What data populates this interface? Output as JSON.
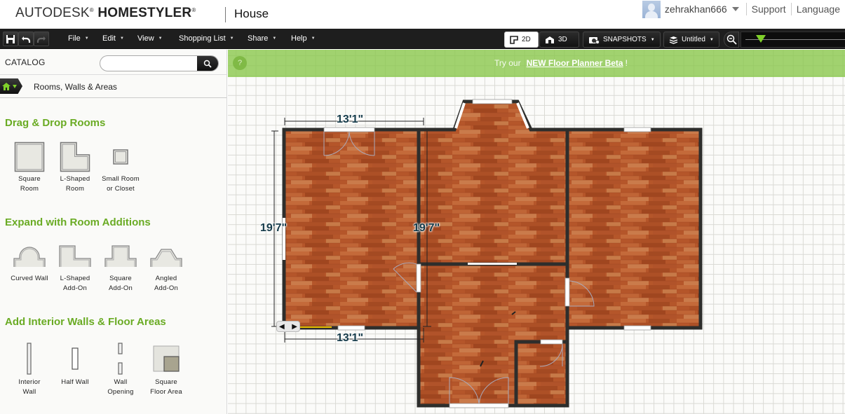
{
  "header": {
    "brand_light": "AUTODESK",
    "brand_bold": "HOMESTYLER",
    "registered": "®",
    "project_name": "House",
    "username": "zehrakhan666",
    "links": [
      "Support",
      "Language"
    ]
  },
  "toolbar": {
    "quick_icons": [
      "save-icon",
      "undo-icon",
      "redo-icon"
    ],
    "menus": [
      {
        "label": "File"
      },
      {
        "label": "Edit"
      },
      {
        "label": "View"
      },
      {
        "label": "Shopping List"
      },
      {
        "label": "Share"
      },
      {
        "label": "Help"
      }
    ],
    "view_2d": "2D",
    "view_3d": "3D",
    "snapshots": "SNAPSHOTS",
    "level": "Untitled",
    "zoom_level": 0.15
  },
  "catalog": {
    "title": "CATALOG",
    "search_placeholder": "",
    "breadcrumb": "Rooms, Walls & Areas",
    "sections": [
      {
        "title": "Drag & Drop Rooms",
        "items": [
          {
            "label": "Square\nRoom",
            "icon": "square-room-icon"
          },
          {
            "label": "L-Shaped\nRoom",
            "icon": "l-shaped-room-icon"
          },
          {
            "label": "Small Room\nor Closet",
            "icon": "small-room-icon"
          }
        ]
      },
      {
        "title": "Expand with Room Additions",
        "items": [
          {
            "label": "Curved Wall",
            "icon": "curved-wall-icon"
          },
          {
            "label": "L-Shaped\nAdd-On",
            "icon": "l-shaped-addon-icon"
          },
          {
            "label": "Square\nAdd-On",
            "icon": "square-addon-icon"
          },
          {
            "label": "Angled\nAdd-On",
            "icon": "angled-addon-icon"
          }
        ]
      },
      {
        "title": "Add Interior Walls & Floor Areas",
        "items": [
          {
            "label": "Interior\nWall",
            "icon": "interior-wall-icon"
          },
          {
            "label": "Half Wall",
            "icon": "half-wall-icon"
          },
          {
            "label": "Wall\nOpening",
            "icon": "wall-opening-icon"
          },
          {
            "label": "Square\nFloor Area",
            "icon": "square-floor-area-icon"
          }
        ]
      }
    ]
  },
  "canvas": {
    "banner_prefix": "Try our",
    "banner_link": "NEW Floor Planner Beta",
    "banner_suffix": "!",
    "help_glyph": "?",
    "dimensions": {
      "top_width": "13'1\"",
      "bottom_width": "13'1\"",
      "left_height": "19'7\"",
      "inner_height": "19'7\""
    }
  },
  "colors": {
    "accent_green": "#6aab24",
    "banner_green": "#8cc850",
    "toolbar_dark": "#1e1e1e",
    "wall": "#2e2e2c",
    "floor": "#b5562a"
  }
}
